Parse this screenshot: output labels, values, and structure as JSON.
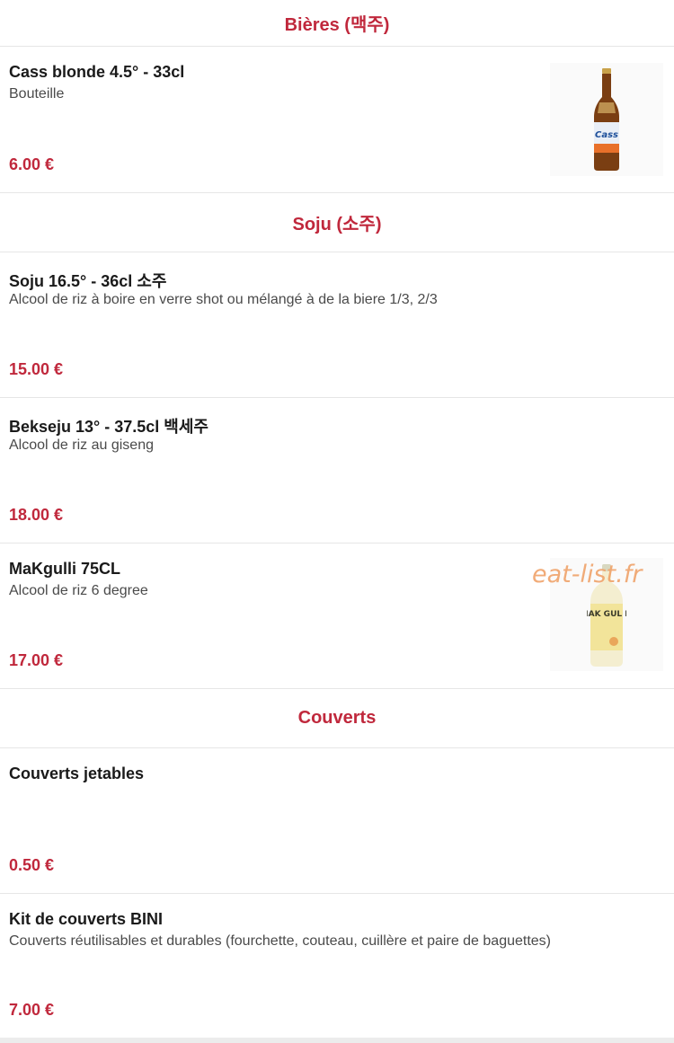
{
  "watermark": "eat-list.fr",
  "sections": {
    "bieres": {
      "title": "Bières (맥주)"
    },
    "soju": {
      "title": "Soju (소주)"
    },
    "couverts": {
      "title": "Couverts"
    }
  },
  "items": {
    "cass": {
      "name": "Cass blonde 4.5° - 33cl",
      "description": "Bouteille",
      "price": "6.00 €",
      "image_icon": "beer-bottle-icon",
      "image_label": "Cass"
    },
    "soju": {
      "name": "Soju 16.5° - 36cl 소주",
      "description": "Alcool de riz à boire en verre shot ou mélangé à de la biere 1/3, 2/3",
      "price": "15.00 €"
    },
    "bekseju": {
      "name": "Bekseju 13° - 37.5cl 백세주",
      "description": "Alcool de riz au giseng",
      "price": "18.00 €"
    },
    "makgulli": {
      "name": "MaKgulli 75CL",
      "description": "Alcool de riz 6 degree",
      "price": "17.00 €",
      "image_icon": "makgulli-bottle-icon",
      "image_label": "MAK GUL LI"
    },
    "couverts_jetables": {
      "name": "Couverts jetables",
      "description": "",
      "price": "0.50 €"
    },
    "kit_bini": {
      "name": "Kit de couverts BINI",
      "description": "Couverts réutilisables et durables (fourchette, couteau, cuillère et paire de baguettes)",
      "price": "7.00 €"
    }
  },
  "colors": {
    "accent": "#c0283c",
    "divider": "#e6e6e6",
    "watermark": "#f0a36a"
  }
}
